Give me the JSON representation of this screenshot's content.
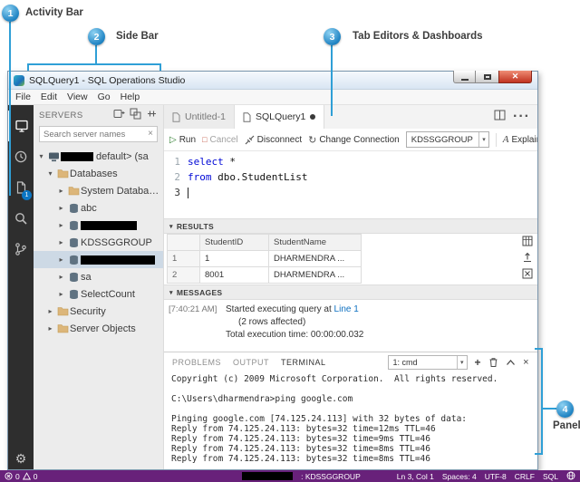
{
  "annotations": {
    "items": [
      {
        "num": "1",
        "label": "Activity Bar"
      },
      {
        "num": "2",
        "label": "Side Bar"
      },
      {
        "num": "3",
        "label": "Tab Editors & Dashboards"
      },
      {
        "num": "4",
        "label": "Panel"
      }
    ]
  },
  "window": {
    "title": "SQLQuery1 - SQL Operations Studio",
    "menu": [
      "File",
      "Edit",
      "View",
      "Go",
      "Help"
    ]
  },
  "activity_bar": {
    "badge": "1"
  },
  "sidebar": {
    "title": "SERVERS",
    "search_placeholder": "Search server names",
    "tree": [
      {
        "label": "default> (sa"
      },
      {
        "label": "Databases"
      },
      {
        "label": "System Databases"
      },
      {
        "label": "abc"
      },
      {
        "label": ""
      },
      {
        "label": "KDSSGGROUP"
      },
      {
        "label": ""
      },
      {
        "label": "sa"
      },
      {
        "label": "SelectCount"
      },
      {
        "label": "Security"
      },
      {
        "label": "Server Objects"
      }
    ]
  },
  "editor_tabs": [
    {
      "label": "Untitled-1"
    },
    {
      "label": "SQLQuery1"
    }
  ],
  "toolbar": {
    "run": "Run",
    "cancel": "Cancel",
    "disconnect": "Disconnect",
    "change_connection": "Change Connection",
    "database": "KDSSGGROUP",
    "explain": "Explain"
  },
  "editor": {
    "line_numbers": [
      "1",
      "2",
      "3"
    ],
    "lines": [
      {
        "keyword": "select",
        "rest": " *"
      },
      {
        "keyword": "from",
        "rest": " dbo.StudentList"
      }
    ]
  },
  "results": {
    "title": "RESULTS",
    "columns": [
      "StudentID",
      "StudentName"
    ],
    "rows": [
      {
        "num": "1",
        "student_id": "1",
        "student_name": "DHARMENDRA ..."
      },
      {
        "num": "2",
        "student_id": "8001",
        "student_name": "DHARMENDRA ..."
      }
    ]
  },
  "messages": {
    "title": "MESSAGES",
    "timestamp": "[7:40:21 AM]",
    "text_before_link": "Started executing query at ",
    "link": "Line 1",
    "rows_affected": "(2 rows affected)",
    "execution_time": "Total execution time: 00:00:00.032"
  },
  "panel": {
    "tabs": [
      "PROBLEMS",
      "OUTPUT",
      "TERMINAL"
    ],
    "terminal_dropdown": "1: cmd",
    "terminal_lines": [
      "Copyright (c) 2009 Microsoft Corporation.  All rights reserved.",
      "",
      "C:\\Users\\dharmendra>ping google.com",
      "",
      "Pinging google.com [74.125.24.113] with 32 bytes of data:",
      "Reply from 74.125.24.113: bytes=32 time=12ms TTL=46",
      "Reply from 74.125.24.113: bytes=32 time=9ms TTL=46",
      "Reply from 74.125.24.113: bytes=32 time=8ms TTL=46",
      "Reply from 74.125.24.113: bytes=32 time=8ms TTL=46"
    ]
  },
  "statusbar": {
    "errors": "0",
    "warnings": "0",
    "connection": ": KDSSGGROUP",
    "position": "Ln 3, Col 1",
    "spaces": "Spaces: 4",
    "encoding": "UTF-8",
    "eol": "CRLF",
    "language": "SQL"
  }
}
